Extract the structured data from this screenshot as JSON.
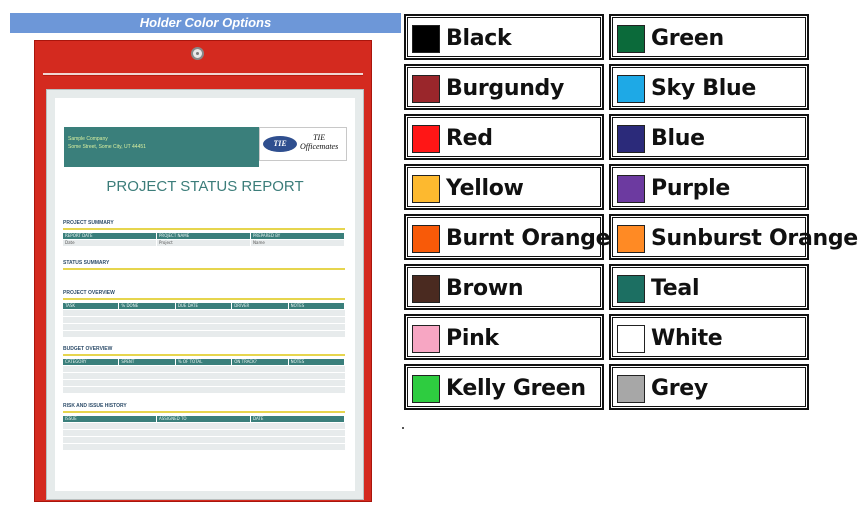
{
  "header": {
    "title": "Holder Color Options"
  },
  "document": {
    "company_line1": "Sample Company",
    "company_line2": "Some Street, Some City, UT 44451",
    "logo_oval": "TIE",
    "logo_line1": "TIE",
    "logo_line2": "Officemates",
    "title": "PROJECT STATUS REPORT",
    "sections": {
      "summary": "PROJECT SUMMARY",
      "status": "STATUS SUMMARY",
      "overview": "PROJECT OVERVIEW",
      "budget": "BUDGET OVERVIEW",
      "risk": "RISK AND ISSUE HISTORY"
    },
    "summary_cols": [
      "REPORT DATE",
      "PROJECT NAME",
      "PREPARED BY"
    ],
    "summary_vals": [
      "Date",
      "Project",
      "Name"
    ],
    "overview_cols": [
      "TASK",
      "% DONE",
      "DUE DATE",
      "DRIVER",
      "NOTES"
    ],
    "budget_cols": [
      "CATEGORY",
      "SPENT",
      "% OF TOTAL",
      "ON TRACK?",
      "NOTES"
    ],
    "risk_cols": [
      "ISSUE",
      "ASSIGNED TO",
      "DATE"
    ]
  },
  "colors": [
    {
      "name": "Black",
      "hex": "#000000"
    },
    {
      "name": "Green",
      "hex": "#0b6a3a"
    },
    {
      "name": "Burgundy",
      "hex": "#9a262b"
    },
    {
      "name": "Sky Blue",
      "hex": "#1ea9e6"
    },
    {
      "name": "Red",
      "hex": "#ff1616"
    },
    {
      "name": "Blue",
      "hex": "#2b2a7a"
    },
    {
      "name": "Yellow",
      "hex": "#fdb92f"
    },
    {
      "name": "Purple",
      "hex": "#6c3aa0"
    },
    {
      "name": "Burnt Orange",
      "hex": "#f85a08"
    },
    {
      "name": "Sunburst Orange",
      "hex": "#ff8a24"
    },
    {
      "name": "Brown",
      "hex": "#4a2a20"
    },
    {
      "name": "Teal",
      "hex": "#1c6f62"
    },
    {
      "name": "Pink",
      "hex": "#f7a6c3"
    },
    {
      "name": "White",
      "hex": "#ffffff"
    },
    {
      "name": "Kelly Green",
      "hex": "#2ecc40"
    },
    {
      "name": "Grey",
      "hex": "#a7a7a7"
    }
  ]
}
